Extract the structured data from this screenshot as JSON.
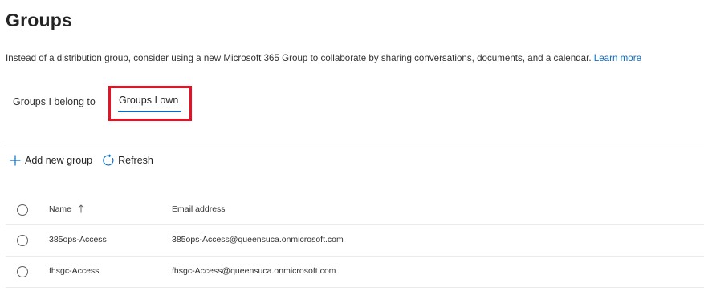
{
  "page": {
    "title": "Groups",
    "intro_text": "Instead of a distribution group, consider using a new Microsoft 365 Group to collaborate by sharing conversations, documents, and a calendar.",
    "learn_more": "Learn more"
  },
  "tabs": [
    {
      "label": "Groups I belong to",
      "selected": false
    },
    {
      "label": "Groups I own",
      "selected": true,
      "highlighted": true
    }
  ],
  "toolbar": {
    "add_label": "Add new group",
    "add_icon": "plus-icon",
    "refresh_label": "Refresh",
    "refresh_icon": "refresh-icon"
  },
  "table": {
    "columns": {
      "name": "Name",
      "email": "Email address"
    },
    "sort": {
      "column": "name",
      "direction": "ascending",
      "icon": "arrow-up-icon"
    },
    "rows": [
      {
        "name": "385ops-Access",
        "email": "385ops-Access@queensuca.onmicrosoft.com"
      },
      {
        "name": "fhsgc-Access",
        "email": "fhsgc-Access@queensuca.onmicrosoft.com"
      }
    ]
  },
  "colors": {
    "accent": "#0f6cbd",
    "highlight_box": "#e81123",
    "text": "#323130"
  }
}
